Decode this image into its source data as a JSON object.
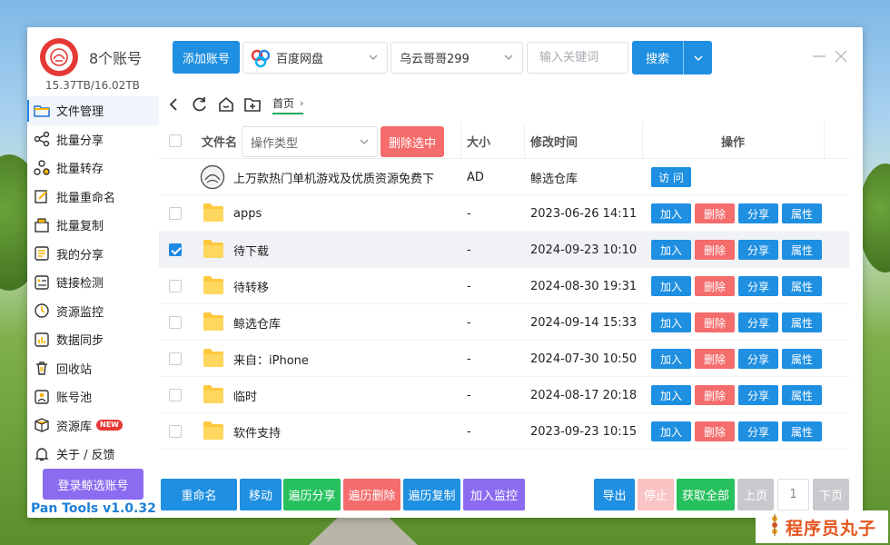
{
  "account": {
    "title": "8个账号",
    "quota": "15.37TB/16.02TB"
  },
  "sidebar": {
    "items": [
      {
        "label": "文件管理",
        "icon": "folder-icon"
      },
      {
        "label": "批量分享",
        "icon": "share-icon"
      },
      {
        "label": "批量转存",
        "icon": "transfer-icon"
      },
      {
        "label": "批量重命名",
        "icon": "rename-icon"
      },
      {
        "label": "批量复制",
        "icon": "copy-icon"
      },
      {
        "label": "我的分享",
        "icon": "my-share-icon"
      },
      {
        "label": "链接检测",
        "icon": "link-check-icon"
      },
      {
        "label": "资源监控",
        "icon": "monitor-icon"
      },
      {
        "label": "数据同步",
        "icon": "sync-chart-icon"
      },
      {
        "label": "回收站",
        "icon": "trash-icon"
      },
      {
        "label": "账号池",
        "icon": "account-pool-icon"
      },
      {
        "label": "资源库",
        "icon": "resource-box-icon",
        "badge": "NEW"
      },
      {
        "label": "关于 / 反馈",
        "icon": "bell-icon"
      }
    ],
    "login_button": "登录鲸选账号",
    "version": "Pan Tools v1.0.32"
  },
  "toolbar": {
    "add_account": "添加账号",
    "pan_type": "百度网盘",
    "user": "乌云哥哥299",
    "keyword_placeholder": "输入关键词",
    "search": "搜索"
  },
  "breadcrumb": {
    "home": "首页"
  },
  "table": {
    "headers": {
      "name": "文件名",
      "op_type_placeholder": "操作类型",
      "delete_selected": "删除选中",
      "size": "大小",
      "modified": "修改时间",
      "actions": "操作"
    },
    "ad_row": {
      "name": "上万款热门单机游戏及优质资源免费下",
      "size": "AD",
      "time": "鲸选仓库",
      "action": "访 问"
    },
    "row_actions": {
      "add": "加入",
      "delete": "删除",
      "share": "分享",
      "props": "属性"
    },
    "rows": [
      {
        "name": "apps",
        "size": "-",
        "time": "2023-06-26 14:11",
        "checked": false
      },
      {
        "name": "待下载",
        "size": "-",
        "time": "2024-09-23 10:10",
        "checked": true
      },
      {
        "name": "待转移",
        "size": "-",
        "time": "2024-08-30 19:31",
        "checked": false
      },
      {
        "name": "鲸选仓库",
        "size": "-",
        "time": "2024-09-14 15:33",
        "checked": false
      },
      {
        "name": "来自：iPhone",
        "size": "-",
        "time": "2024-07-30 10:50",
        "checked": false
      },
      {
        "name": "临时",
        "size": "-",
        "time": "2024-08-17 20:18",
        "checked": false
      },
      {
        "name": "软件支持",
        "size": "-",
        "time": "2023-09-23 10:15",
        "checked": false
      }
    ]
  },
  "bottom": {
    "rename": "重命名",
    "move": "移动",
    "traverse_share": "遍历分享",
    "traverse_delete": "遍历删除",
    "traverse_copy": "遍历复制",
    "add_monitor": "加入监控",
    "export": "导出",
    "stop": "停止",
    "get_all": "获取全部",
    "prev": "上页",
    "page": "1",
    "next": "下页"
  },
  "watermark": "程序员丸子",
  "colors": {
    "primary": "#1e8fe1",
    "danger": "#f56c6c",
    "success": "#26c15e",
    "purple": "#8b6cf0"
  }
}
